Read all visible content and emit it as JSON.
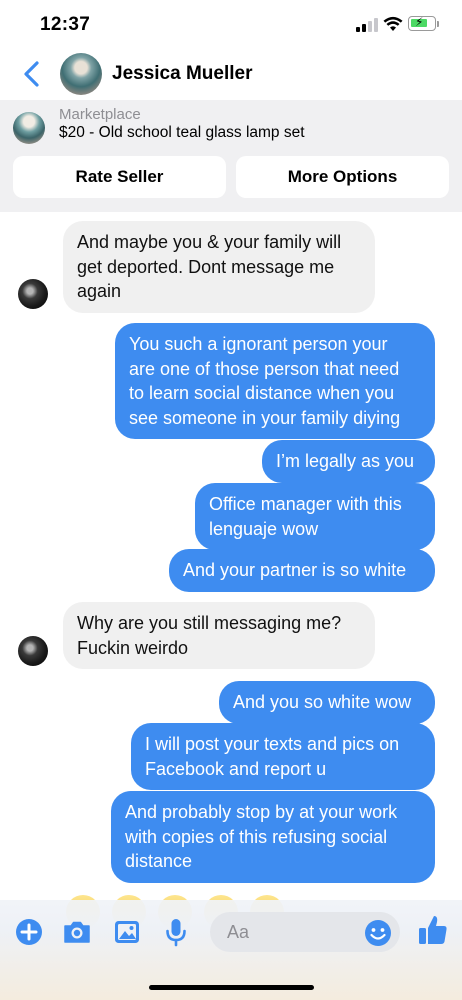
{
  "status_bar": {
    "time": "12:37"
  },
  "header": {
    "name": "Jessica Mueller"
  },
  "marketplace": {
    "category": "Marketplace",
    "title": "$20 - Old school teal glass lamp set",
    "rate_seller": "Rate Seller",
    "more_options": "More Options"
  },
  "messages": [
    {
      "side": "in",
      "text": "And maybe you & your family will\nget deported. Dont message me\nagain"
    },
    {
      "side": "out",
      "text": "You such a ignorant person your\nare one of those person that need\nto learn social distance when you\nsee someone in your family diying"
    },
    {
      "side": "out",
      "text": "I’m legally as you"
    },
    {
      "side": "out",
      "text": "Office manager with this\nlenguaje wow"
    },
    {
      "side": "out",
      "text": "And your partner is so white"
    },
    {
      "side": "in",
      "text": "Why are you still messaging me?\nFuckin weirdo"
    },
    {
      "side": "out",
      "text": "And you so white wow"
    },
    {
      "side": "out",
      "text": "I will post your texts and pics on\nFacebook and report u"
    },
    {
      "side": "out",
      "text": "And probably stop by at your work\nwith copies of this refusing social\ndistance"
    }
  ],
  "composer": {
    "placeholder": "Aa",
    "icons": [
      "plus-icon",
      "camera-icon",
      "image-icon",
      "microphone-icon",
      "emoji-icon",
      "thumbs-up-icon"
    ]
  },
  "colors": {
    "accent": "#3e8cf0",
    "incoming_bubble": "#f0f0f0"
  }
}
